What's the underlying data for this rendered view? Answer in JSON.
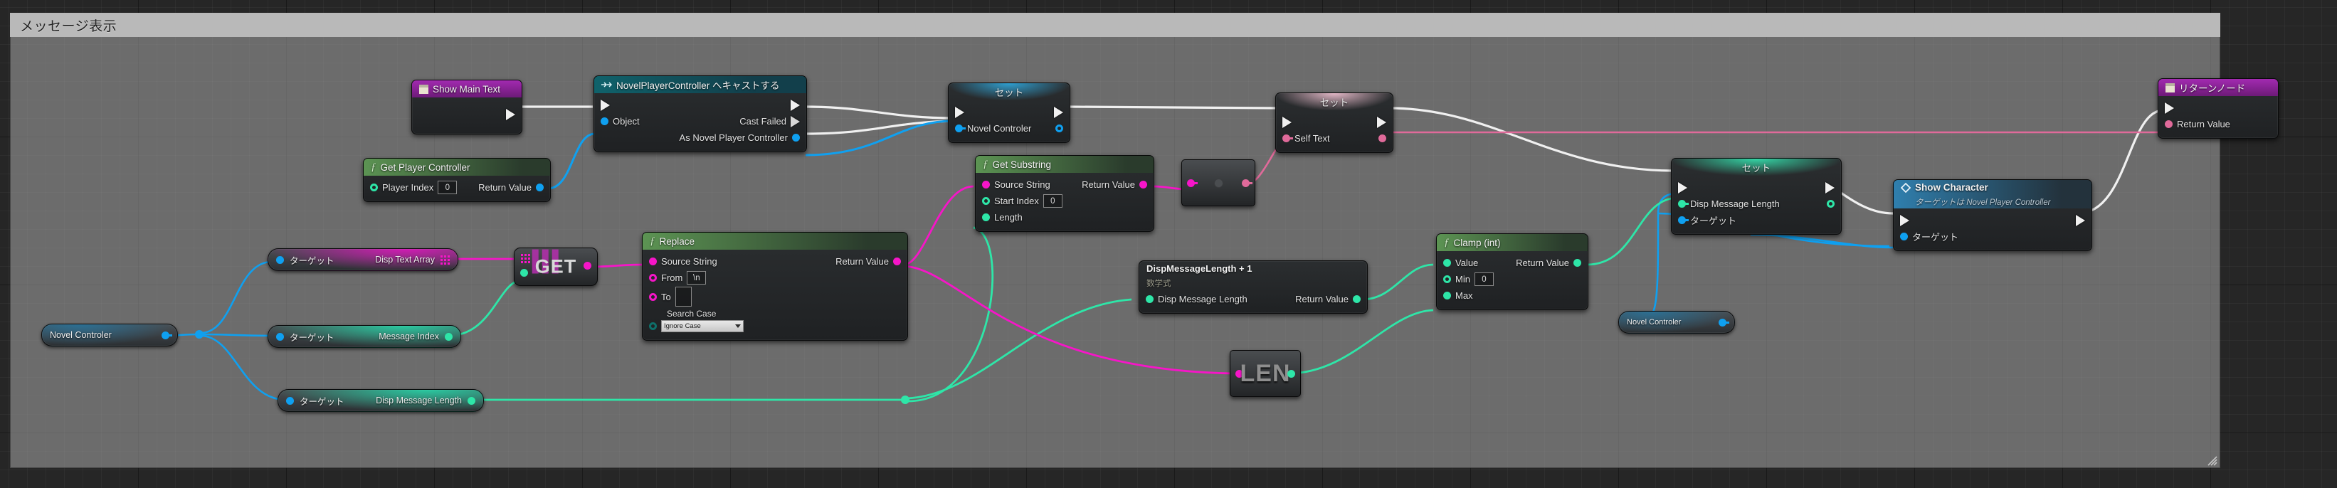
{
  "comment": {
    "title": "メッセージ表示"
  },
  "nodes": {
    "show_main_text": {
      "title": "Show Main Text"
    },
    "cast_node": {
      "title": "NovelPlayerController へキャストする",
      "in_object": "Object",
      "out_cast_failed": "Cast Failed",
      "out_as": "As Novel Player Controller"
    },
    "get_player_controller": {
      "title": "Get Player Controller",
      "in_player_index": "Player Index",
      "player_index_value": "0",
      "out_return": "Return Value"
    },
    "set_novel_controler": {
      "title": "セット",
      "pin": "Novel Controler"
    },
    "set_self_text": {
      "title": "セット",
      "pin": "Self Text"
    },
    "get_substring": {
      "title": "Get Substring",
      "in_source": "Source String",
      "in_start": "Start Index",
      "start_value": "0",
      "in_length": "Length",
      "out_return": "Return Value"
    },
    "replace": {
      "title": "Replace",
      "in_source": "Source String",
      "in_from": "From",
      "from_value": "\\n",
      "in_to": "To",
      "to_value": "",
      "search_case_label": "Search Case",
      "search_case_value": "Ignore Case",
      "out_return": "Return Value"
    },
    "to_text": {
      "title": ""
    },
    "len": {
      "title": "LEN"
    },
    "get_array": {
      "title": "GET"
    },
    "math_expr": {
      "title": "DispMessageLength + 1",
      "subtitle": "数学式",
      "in_pin": "Disp Message Length",
      "out_return": "Return Value"
    },
    "clamp": {
      "title": "Clamp (int)",
      "in_value": "Value",
      "in_min": "Min",
      "min_value": "0",
      "in_max": "Max",
      "out_return": "Return Value"
    },
    "set_disp_len": {
      "title": "セット",
      "pin": "Disp Message Length",
      "target": "ターゲット"
    },
    "show_character": {
      "title": "Show Character",
      "subtitle": "ターゲットは Novel Player Controller",
      "target": "ターゲット"
    },
    "return_node": {
      "title": "リターンノード",
      "out_return": "Return Value"
    }
  },
  "variables": {
    "novel_controler_left": {
      "label": "Novel Controler"
    },
    "novel_controler_right": {
      "label": "Novel Controler"
    },
    "disp_text_array": {
      "target": "ターゲット",
      "label": "Disp Text Array"
    },
    "message_index": {
      "target": "ターゲット",
      "label": "Message Index"
    },
    "disp_message_len": {
      "target": "ターゲット",
      "label": "Disp Message Length"
    }
  },
  "colors": {
    "exec": "#f0f0f0",
    "object_blue": "#0fa0f0",
    "string_pink": "#f615c8",
    "text_pink": "#e06a9a",
    "int_green": "#2ee6a8",
    "enum_teal": "#0e6f6a",
    "comment_bar": "#b9b9b9"
  }
}
